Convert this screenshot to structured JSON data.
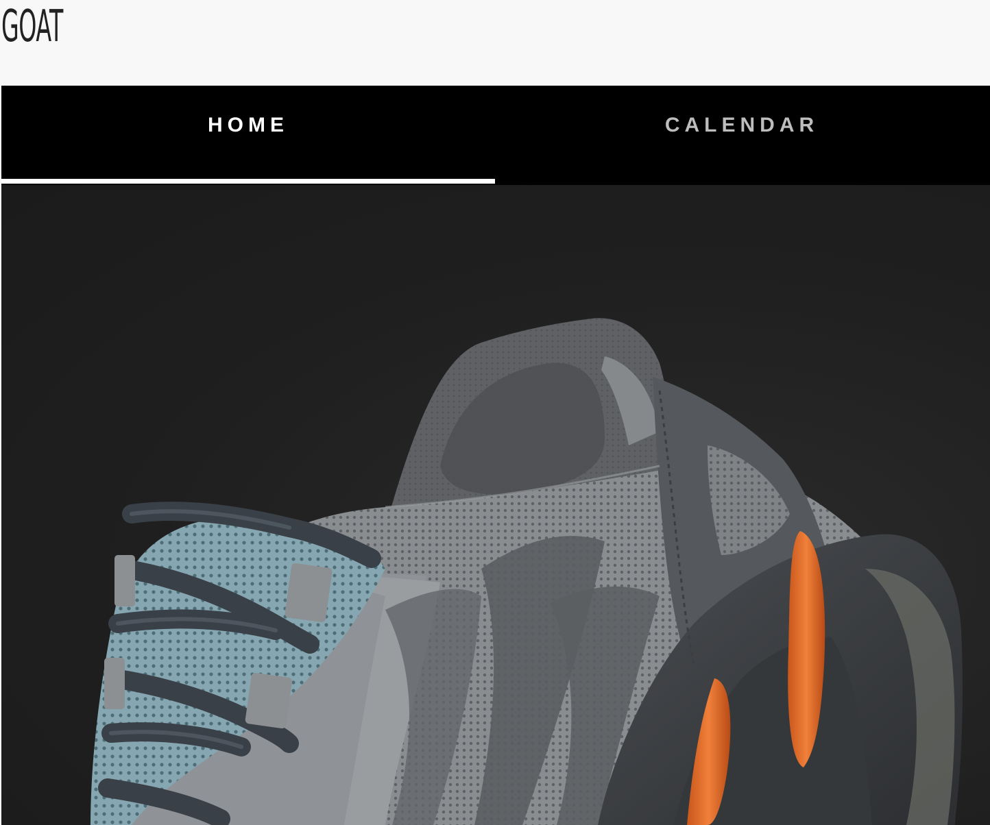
{
  "header": {
    "logo_text": "GOAT"
  },
  "tabs": [
    {
      "label": "HOME",
      "active": true
    },
    {
      "label": "CALENDAR",
      "active": false
    }
  ],
  "hero": {
    "image_icon": "sneaker-image",
    "colors": {
      "background": "#1f1f1f",
      "upper_grey": "#6b6f73",
      "mesh_blue": "#7fa1ab",
      "sole_dark": "#3f4245",
      "accent_orange": "#e8702a",
      "lace_dark": "#3a4048"
    }
  }
}
